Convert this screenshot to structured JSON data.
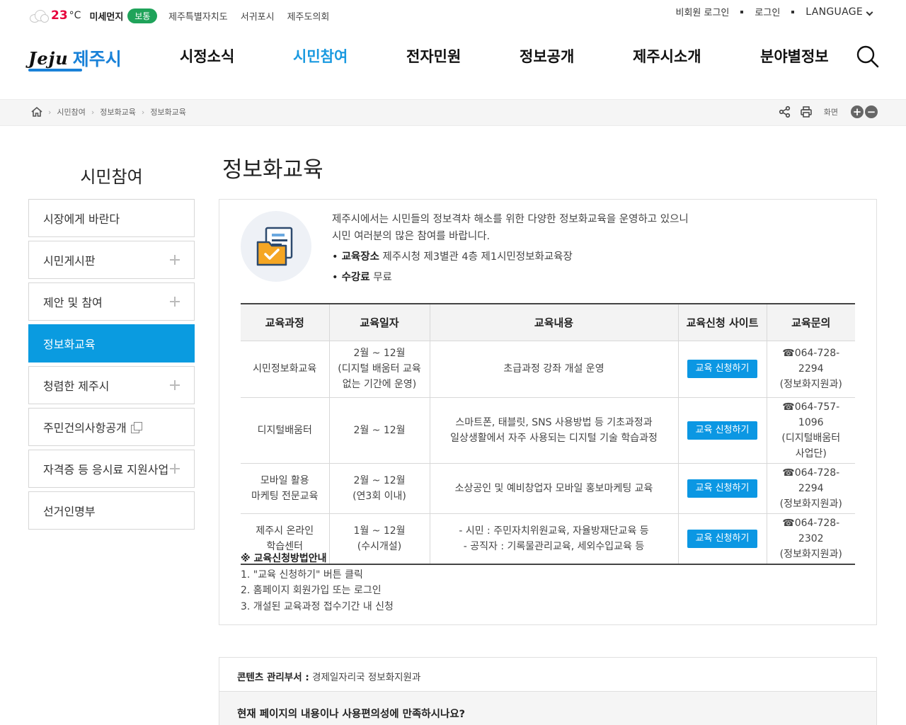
{
  "weather": {
    "temperature": "23",
    "unit": "°C",
    "dust_label": "미세먼지",
    "dust_status": "보통",
    "dust_status_color": "#1fa35a"
  },
  "top_links": [
    "제주특별자치도",
    "서귀포시",
    "제주도의회"
  ],
  "account": {
    "guest_login": "비회원 로그인",
    "login": "로그인",
    "language": "LANGUAGE"
  },
  "logo": {
    "text_en": "Jeju",
    "text_ko": "제주시"
  },
  "gnb": [
    "시정소식",
    "시민참여",
    "전자민원",
    "정보공개",
    "제주시소개",
    "분야별정보"
  ],
  "gnb_active": "시민참여",
  "breadcrumb": [
    "시민참여",
    "정보화교육",
    "정보화교육"
  ],
  "tools": {
    "screen_label": "화면",
    "zoom_in": "+",
    "zoom_out": "−"
  },
  "sidebar": {
    "title": "시민참여",
    "items": [
      {
        "label": "시장에게 바란다",
        "expandable": false
      },
      {
        "label": "시민게시판",
        "expandable": true
      },
      {
        "label": "제안 및 참여",
        "expandable": true
      },
      {
        "label": "정보화교육",
        "expandable": false,
        "active": true
      },
      {
        "label": "청렴한 제주시",
        "expandable": true
      },
      {
        "label": "주민건의사항공개",
        "expandable": false,
        "new_window": true
      },
      {
        "label": "자격증 등 응시료 지원사업",
        "expandable": true
      },
      {
        "label": "선거인명부",
        "expandable": false
      }
    ]
  },
  "page": {
    "title": "정보화교육",
    "intro_line1": "제주시에서는 시민들의 정보격차 해소를 위한 다양한 정보화교육을 운영하고 있으니",
    "intro_line2": "시민 여러분의 많은 참여를 바랍니다.",
    "place_label": "교육장소",
    "place_value": "제주시청 제3별관 4층 제1시민정보화교육장",
    "fee_label": "수강료",
    "fee_value": "무료"
  },
  "table": {
    "headers": [
      "교육과정",
      "교육일자",
      "교육내용",
      "교육신청 사이트",
      "교육문의"
    ],
    "rows": [
      {
        "course": [
          "시민정보화교육"
        ],
        "date": [
          "2월 ~ 12월",
          "(디지털 배움터 교육",
          "없는 기간에 운영)"
        ],
        "content": [
          "초급과정 강좌 개설 운영"
        ],
        "button": "교육 신청하기",
        "contact": [
          "☎064-728-2294",
          "(정보화지원과)"
        ]
      },
      {
        "course": [
          "디지털배움터"
        ],
        "date": [
          "2월 ~ 12월"
        ],
        "content": [
          "스마트폰, 태블릿, SNS 사용방법 등 기초과정과",
          "일상생활에서 자주 사용되는 디지털 기술 학습과정"
        ],
        "button": "교육 신청하기",
        "contact": [
          "☎064-757-1096",
          "(디지털배움터",
          "사업단)"
        ]
      },
      {
        "course": [
          "모바일 활용",
          "마케팅 전문교육"
        ],
        "date": [
          "2월 ~ 12월",
          "(연3회 이내)"
        ],
        "content": [
          "소상공인 및 예비창업자 모바일 홍보마케팅 교육"
        ],
        "button": "교육 신청하기",
        "contact": [
          "☎064-728-2294",
          "(정보화지원과)"
        ]
      },
      {
        "course": [
          "제주시 온라인",
          "학습센터"
        ],
        "date": [
          "1월 ~ 12월",
          "(수시개설)"
        ],
        "content": [
          "- 시민 : 주민자치위원교육, 자율방재단교육 등",
          "- 공직자 : 기록물관리교육, 세외수입교육 등"
        ],
        "button": "교육 신청하기",
        "contact": [
          "☎064-728-2302",
          "(정보화지원과)"
        ]
      }
    ]
  },
  "notes": {
    "heading": "※ 교육신청방법안내",
    "steps": [
      "1. \"교육 신청하기\" 버튼 클릭",
      "2. 홈페이지 회원가입 또는 로그인",
      "3. 개설된 교육과정 접수기간 내 신청"
    ]
  },
  "manager": {
    "label": "콘텐츠 관리부서 :",
    "value": "경제일자리국 정보화지원과"
  },
  "survey": {
    "question": "현재 페이지의 내용이나 사용편의성에 만족하시나요?"
  },
  "colors": {
    "accent": "#0a9be0",
    "gnb_active": "#1a9ae0",
    "temp": "#e6003c"
  }
}
